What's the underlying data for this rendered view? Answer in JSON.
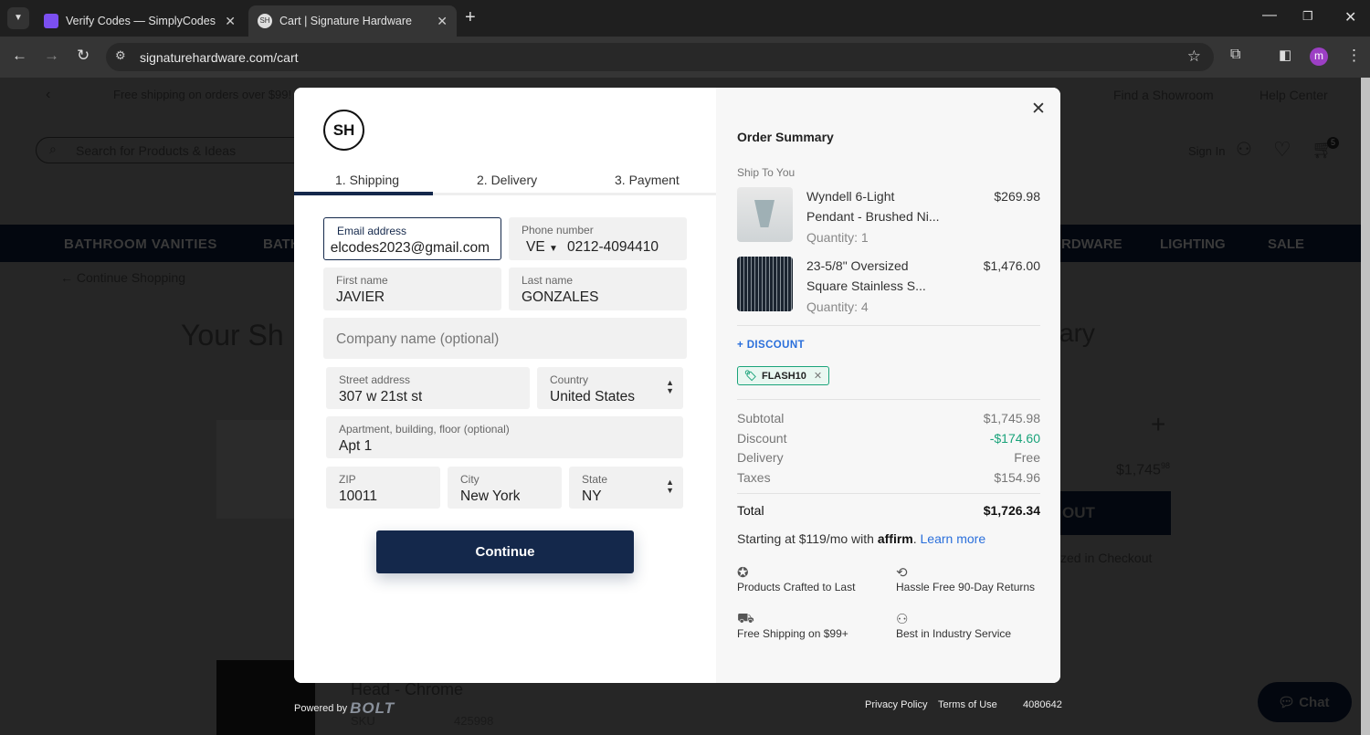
{
  "browser": {
    "tabs": [
      {
        "title": "Verify Codes — SimplyCodes",
        "active": false
      },
      {
        "title": "Cart | Signature Hardware",
        "active": true
      }
    ],
    "url": "signaturehardware.com/cart",
    "profile_initial": "m"
  },
  "site": {
    "promo": "Free shipping on orders over $99!",
    "search_placeholder": "Search for Products & Ideas",
    "top_links": [
      "Find a Showroom",
      "Help Center"
    ],
    "sign_in": "Sign In",
    "cart_count": "5",
    "nav": [
      "BATHROOM VANITIES",
      "BATH",
      "RDWARE",
      "LIGHTING",
      "SALE"
    ],
    "continue_shopping": "Continue Shopping",
    "heading_left": "Your Sh",
    "heading_right": "ary",
    "cart_total": "$1,745",
    "cart_total_cents": "98",
    "checkout_btn": "OUT",
    "checkout_note": "zed in Checkout",
    "item_title": "Head - Chrome",
    "sku_label": "SKU",
    "sku": "425998",
    "chat": "Chat"
  },
  "checkout": {
    "logo": "SH",
    "steps": [
      "1. Shipping",
      "2. Delivery",
      "3. Payment"
    ],
    "progress_fraction": 0.33,
    "form": {
      "email": {
        "label": "Email address",
        "value": "elcodes2023@gmail.com"
      },
      "phone": {
        "label": "Phone number",
        "country": "VE",
        "value": "0212-4094410"
      },
      "first_name": {
        "label": "First name",
        "value": "JAVIER"
      },
      "last_name": {
        "label": "Last name",
        "value": "GONZALES"
      },
      "company": {
        "placeholder": "Company name (optional)"
      },
      "street": {
        "label": "Street address",
        "value": "307 w 21st st"
      },
      "country": {
        "label": "Country",
        "value": "United States"
      },
      "apt": {
        "label": "Apartment, building, floor (optional)",
        "value": "Apt 1"
      },
      "zip": {
        "label": "ZIP",
        "value": "10011"
      },
      "city": {
        "label": "City",
        "value": "New York"
      },
      "state": {
        "label": "State",
        "value": "NY"
      }
    },
    "continue": "Continue",
    "summary": {
      "title": "Order Summary",
      "ship_label": "Ship To You",
      "items": [
        {
          "name1": "Wyndell 6-Light",
          "name2": "Pendant - Brushed Ni...",
          "qty": "Quantity: 1",
          "price": "$269.98"
        },
        {
          "name1": "23-5/8\" Oversized",
          "name2": "Square Stainless S...",
          "qty": "Quantity: 4",
          "price": "$1,476.00"
        }
      ],
      "discount_link": "+ DISCOUNT",
      "code": "FLASH10",
      "rows": [
        {
          "label": "Subtotal",
          "value": "$1,745.98"
        },
        {
          "label": "Discount",
          "value": "-$174.60"
        },
        {
          "label": "Delivery",
          "value": "Free"
        },
        {
          "label": "Taxes",
          "value": "$154.96"
        }
      ],
      "total_label": "Total",
      "total": "$1,726.34",
      "affirm_prefix": "Starting at $119/mo with",
      "affirm_logo": "affirm",
      "learn_more": "Learn more",
      "features": [
        "Products Crafted to Last",
        "Hassle Free 90-Day Returns",
        "Free Shipping on $99+",
        "Best in Industry Service"
      ]
    },
    "colors": {
      "navy": "#14284b",
      "green": "#1aa37a",
      "link": "#2a6fdb"
    }
  },
  "footer": {
    "powered_by": "Powered by",
    "bolt": "BOLT",
    "privacy": "Privacy Policy",
    "terms": "Terms of Use",
    "id": "4080642"
  }
}
